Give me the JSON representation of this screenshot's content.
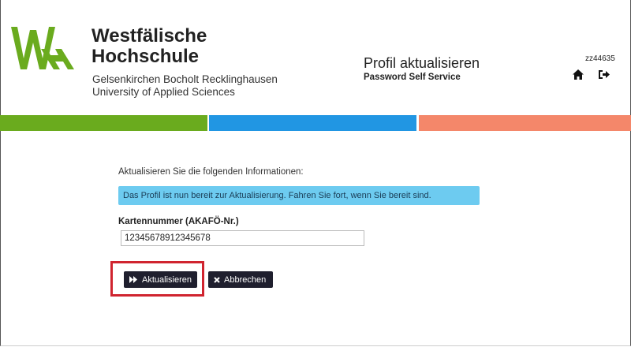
{
  "header": {
    "school_name_line1": "Westfälische",
    "school_name_line2": "Hochschule",
    "school_sub_line1": "Gelsenkirchen Bocholt Recklinghausen",
    "school_sub_line2": "University of Applied Sciences",
    "page_title": "Profil aktualisieren",
    "page_subtitle": "Password Self Service",
    "username": "zz44635",
    "icons": [
      "home-icon",
      "logout-icon"
    ]
  },
  "colors": {
    "green": "#6aab1e",
    "blue": "#2196e3",
    "salmon": "#f4876a",
    "alert_bg": "#6dcbf0",
    "button_bg": "#1f1f2e",
    "highlight": "#d0242f"
  },
  "form": {
    "intro": "Aktualisieren Sie die folgenden Informationen:",
    "alert": "Das Profil ist nun bereit zur Aktualisierung. Fahren Sie fort, wenn Sie bereit sind.",
    "card_label": "Kartennummer (AKAFÖ-Nr.)",
    "card_value": "12345678912345678",
    "update_label": "Aktualisieren",
    "cancel_label": "Abbrechen"
  }
}
